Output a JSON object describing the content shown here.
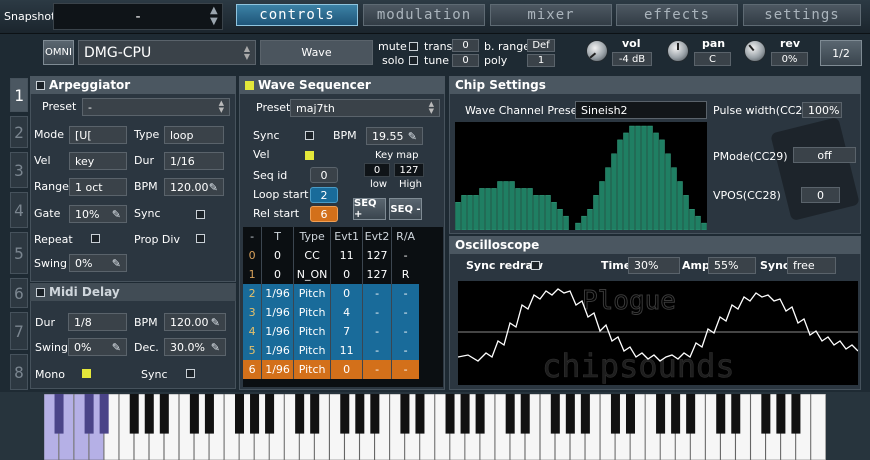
{
  "header": {
    "snapshot_label": "Snapshot",
    "snapshot_value": "-",
    "tabs": [
      {
        "label": "controls",
        "active": true
      },
      {
        "label": "modulation",
        "active": false
      },
      {
        "label": "mixer",
        "active": false
      },
      {
        "label": "effects",
        "active": false
      },
      {
        "label": "settings",
        "active": false
      }
    ]
  },
  "instrument_bar": {
    "omni": "OMNI",
    "preset": "DMG-CPU",
    "wave_button": "Wave",
    "mute": "mute",
    "solo": "solo",
    "trans_label": "trans",
    "trans_value": "0",
    "tune_label": "tune",
    "tune_value": "0",
    "brange_label": "b. range",
    "brange_value": "Def",
    "poly_label": "poly",
    "poly_value": "1",
    "vol_label": "vol",
    "vol_value": "-4 dB",
    "pan_label": "pan",
    "pan_value": "C",
    "rev_label": "rev",
    "rev_value": "0%",
    "page": "1/2"
  },
  "side_tabs": [
    "1",
    "2",
    "3",
    "4",
    "5",
    "6",
    "7",
    "8"
  ],
  "arpeggiator": {
    "title": "Arpeggiator",
    "preset_label": "Preset",
    "preset_value": "-",
    "mode_label": "Mode",
    "mode_value": "[U[",
    "type_label": "Type",
    "type_value": "loop",
    "vel_label": "Vel",
    "vel_value": "key",
    "dur_label": "Dur",
    "dur_value": "1/16",
    "range_label": "Range",
    "range_value": "1 oct",
    "bpm_label": "BPM",
    "bpm_value": "120.00",
    "gate_label": "Gate",
    "gate_value": "10%",
    "sync_label": "Sync",
    "repeat_label": "Repeat",
    "propdiv_label": "Prop Div",
    "swing_label": "Swing",
    "swing_value": "0%"
  },
  "midi_delay": {
    "title": "Midi Delay",
    "dur_label": "Dur",
    "dur_value": "1/8",
    "bpm_label": "BPM",
    "bpm_value": "120.00",
    "swing_label": "Swing",
    "swing_value": "0%",
    "dec_label": "Dec.",
    "dec_value": "30.0%",
    "mono_label": "Mono",
    "sync_label": "Sync"
  },
  "wave_sequencer": {
    "title": "Wave Sequencer",
    "preset_label": "Preset",
    "preset_value": "maj7th",
    "sync_label": "Sync",
    "bpm_label": "BPM",
    "bpm_value": "19.55",
    "vel_label": "Vel",
    "keymap_label": "Key map",
    "keymap_low": "0",
    "keymap_high": "127",
    "low_label": "low",
    "high_label": "High",
    "seqid_label": "Seq id",
    "seqid_value": "0",
    "loopstart_label": "Loop start",
    "loopstart_value": "2",
    "relstart_label": "Rel start",
    "relstart_value": "6",
    "seq_plus": "SEQ +",
    "seq_minus": "SEQ -",
    "columns": [
      "-",
      "T",
      "Type",
      "Evt1",
      "Evt2",
      "R/A"
    ],
    "rows": [
      [
        "0",
        "0",
        "CC",
        "11",
        "127",
        "-"
      ],
      [
        "1",
        "0",
        "N_ON",
        "0",
        "127",
        "R"
      ],
      [
        "2",
        "1/96",
        "Pitch",
        "0",
        "-",
        "-"
      ],
      [
        "3",
        "1/96",
        "Pitch",
        "4",
        "-",
        "-"
      ],
      [
        "4",
        "1/96",
        "Pitch",
        "7",
        "-",
        "-"
      ],
      [
        "5",
        "1/96",
        "Pitch",
        "11",
        "-",
        "-"
      ],
      [
        "6",
        "1/96",
        "Pitch",
        "0",
        "-",
        "-"
      ]
    ]
  },
  "chip_settings": {
    "title": "Chip Settings",
    "wave_preset_label": "Wave Channel Preset:",
    "wave_preset_value": "Sineish2",
    "pulse_label": "Pulse width(CC2)",
    "pulse_value": "100%",
    "pmode_label": "PMode(CC29)",
    "pmode_value": "off",
    "vpos_label": "VPOS(CC28)",
    "vpos_value": "0",
    "wave_bars": [
      4,
      5,
      5,
      5,
      6,
      6,
      6,
      7,
      7,
      7,
      6,
      6,
      6,
      5,
      5,
      5,
      4,
      3,
      2,
      0,
      1,
      2,
      3,
      5,
      7,
      9,
      11,
      13,
      14,
      15,
      15,
      15,
      15,
      14,
      13,
      11,
      9,
      7,
      5,
      3,
      2,
      1
    ]
  },
  "oscilloscope": {
    "title": "Oscilloscope",
    "sync_redraw_label": "Sync redraw",
    "time_label": "Time",
    "time_value": "30%",
    "amp_label": "Amp",
    "amp_value": "55%",
    "sync_label": "Sync",
    "sync_value": "free",
    "logo_top": "Plogue",
    "logo_bottom": "chipsounds"
  },
  "colors": {
    "accent_blue": "#196b9a",
    "accent_orange": "#d3701a",
    "wave_green": "#1f7f63",
    "check_yellow": "#e5e83a"
  }
}
